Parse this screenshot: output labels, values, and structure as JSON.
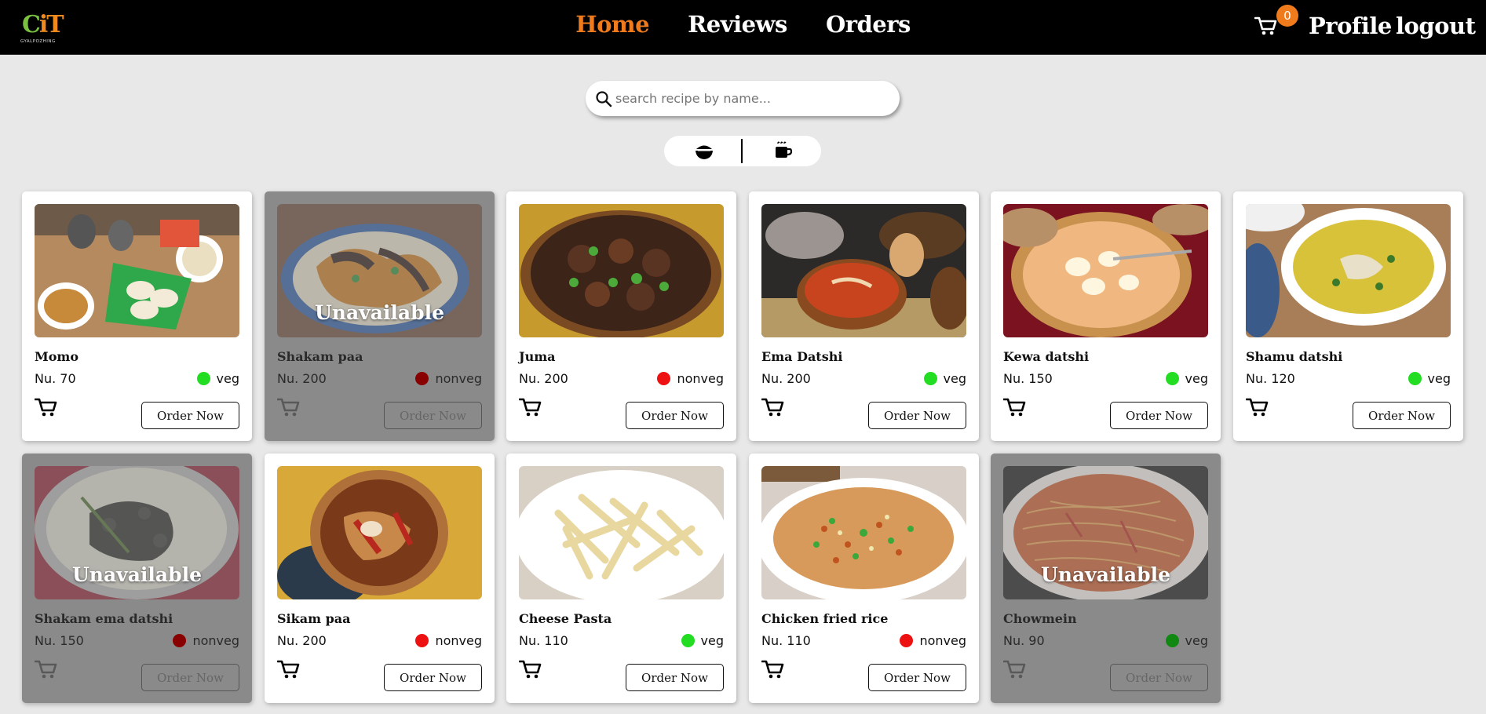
{
  "app": {
    "logo_text": "CiT",
    "logo_subtext": "GYALPOZHING",
    "accent_color": "#f07b1d"
  },
  "nav": {
    "links": [
      {
        "label": "Home",
        "active": true
      },
      {
        "label": "Reviews",
        "active": false
      },
      {
        "label": "Orders",
        "active": false
      }
    ],
    "cart_count": "0",
    "profile_label": "Profile",
    "logout_label": "logout"
  },
  "search": {
    "placeholder": "search recipe by name...",
    "value": ""
  },
  "categories": {
    "items": [
      {
        "icon": "food-bowl-icon"
      },
      {
        "icon": "drink-cup-icon"
      }
    ]
  },
  "dishes": [
    {
      "name": "Momo",
      "price": "Nu. 70",
      "type": "veg",
      "available": true,
      "unavailable_label": ""
    },
    {
      "name": "Shakam paa",
      "price": "Nu. 200",
      "type": "nonveg",
      "available": false,
      "unavailable_label": "Unavailable"
    },
    {
      "name": "Juma",
      "price": "Nu. 200",
      "type": "nonveg",
      "available": true,
      "unavailable_label": ""
    },
    {
      "name": "Ema Datshi",
      "price": "Nu. 200",
      "type": "veg",
      "available": true,
      "unavailable_label": ""
    },
    {
      "name": "Kewa datshi",
      "price": "Nu. 150",
      "type": "veg",
      "available": true,
      "unavailable_label": ""
    },
    {
      "name": "Shamu datshi",
      "price": "Nu. 120",
      "type": "veg",
      "available": true,
      "unavailable_label": ""
    },
    {
      "name": "Shakam ema datshi",
      "price": "Nu. 150",
      "type": "nonveg",
      "available": false,
      "unavailable_label": "Unavailable"
    },
    {
      "name": "Sikam paa",
      "price": "Nu. 200",
      "type": "nonveg",
      "available": true,
      "unavailable_label": ""
    },
    {
      "name": "Cheese Pasta",
      "price": "Nu. 110",
      "type": "veg",
      "available": true,
      "unavailable_label": ""
    },
    {
      "name": "Chicken fried rice",
      "price": "Nu. 110",
      "type": "nonveg",
      "available": true,
      "unavailable_label": ""
    },
    {
      "name": "Chowmein",
      "price": "Nu. 90",
      "type": "veg",
      "available": false,
      "unavailable_label": "Unavailable"
    }
  ],
  "order_label": "Order Now",
  "colors": {
    "veg": "#22dd22",
    "nonveg": "#ee1111",
    "veg_dim": "#118811",
    "nonveg_dim": "#880000",
    "unavailable_bg": "#8a8a8a"
  }
}
